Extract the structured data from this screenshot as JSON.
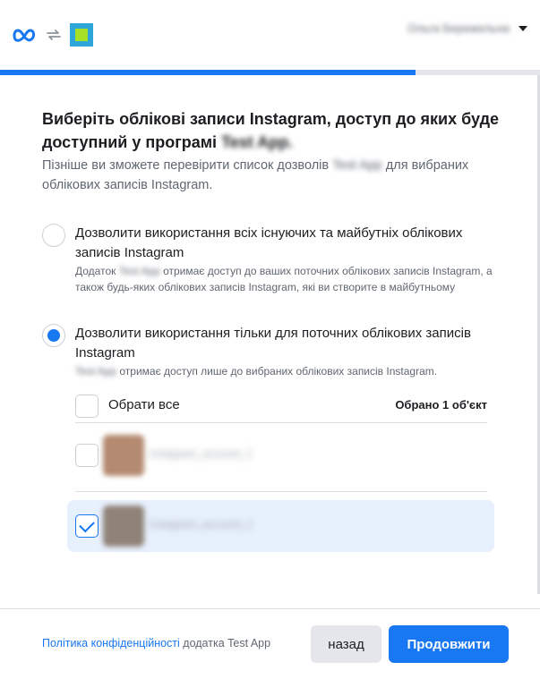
{
  "header": {
    "logo_icons": [
      "meta-logo-icon",
      "sync-arrows-icon",
      "app-icon"
    ],
    "account_name": "Ольга Бережельна",
    "colors": {
      "brand": "#1877f2",
      "progress_track": "#e4e6eb"
    }
  },
  "progress": {
    "fraction": 0.77
  },
  "main": {
    "title": "Виберіть облікові записи Instagram, доступ до яких буде доступний у програмі",
    "title_app": "Test App.",
    "subtitle_before": "Пізніше ви зможете перевірити список дозволів",
    "subtitle_app": "Test App",
    "subtitle_after": "для вибраних облікових записів Instagram."
  },
  "options": [
    {
      "label": "Дозволити використання всіх існуючих та майбутніх облікових записів Instagram",
      "desc_prefix": "Додаток",
      "desc_app": "Test App",
      "desc_rest": "отримає доступ до ваших поточних облікових записів Instagram, а також будь-яких облікових записів Instagram, які ви створите в майбутньому",
      "selected": false
    },
    {
      "label": "Дозволити використання тільки для поточних облікових записів Instagram",
      "desc_app": "Test App",
      "desc_rest": "отримає доступ лише до вибраних облікових записів Instagram.",
      "selected": true
    }
  ],
  "accounts": {
    "select_all_label": "Обрати все",
    "selected_count": "Обрано 1 об'єкт",
    "items": [
      {
        "name": "instagram_account_1",
        "checked": false
      },
      {
        "name": "instagram_account_2",
        "checked": true
      }
    ]
  },
  "footer": {
    "policy_link": "Політика конфіденційності",
    "policy_rest": "додатка Test App",
    "back_label": "назад",
    "next_label": "Продовжити"
  }
}
